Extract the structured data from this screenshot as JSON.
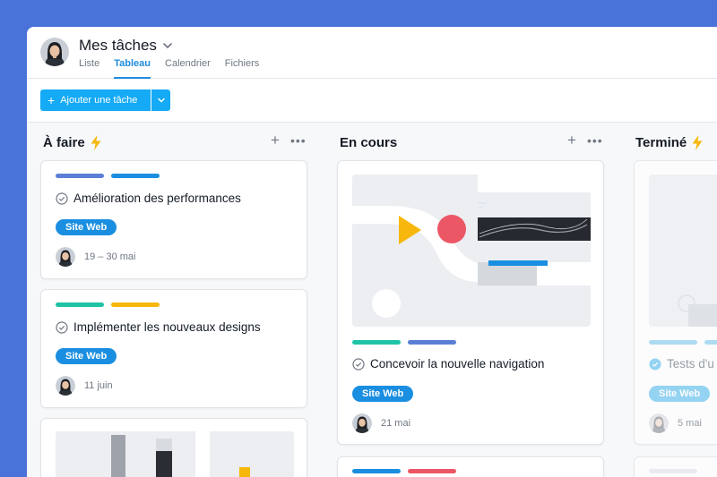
{
  "header": {
    "title": "Mes tâches",
    "tabs": [
      {
        "label": "Liste",
        "active": false
      },
      {
        "label": "Tableau",
        "active": true
      },
      {
        "label": "Calendrier",
        "active": false
      },
      {
        "label": "Fichiers",
        "active": false
      }
    ]
  },
  "toolbar": {
    "add_label": "Ajouter une tâche"
  },
  "colors": {
    "accent": "#14aaf5",
    "tab_active": "#1f8bde",
    "bolt": "#f7b70c"
  },
  "columns": [
    {
      "title": "À faire",
      "icon": "bolt-icon",
      "cards": [
        {
          "bars": [
            "#5b7fd6",
            "#1a8ee0"
          ],
          "task": "Amélioration des performances",
          "tag": "Site Web",
          "date": "19 – 30 mai"
        },
        {
          "bars": [
            "#1fc3a5",
            "#f7b70c"
          ],
          "task": "Implémenter les nouveaux designs",
          "tag": "Site Web",
          "date": "11 juin"
        }
      ]
    },
    {
      "title": "En cours",
      "cards": [
        {
          "bars": [
            "#1fc3a5",
            "#5b7fd6"
          ],
          "task": "Concevoir la nouvelle navigation",
          "tag": "Site Web",
          "date": "21 mai"
        }
      ]
    },
    {
      "title": "Terminé",
      "icon": "bolt-icon",
      "cards": [
        {
          "bars": [
            "#8fd0ef",
            "#8fd0ef"
          ],
          "task": "Tests d'u",
          "tag": "Site Web",
          "date": "5 mai"
        }
      ]
    }
  ]
}
